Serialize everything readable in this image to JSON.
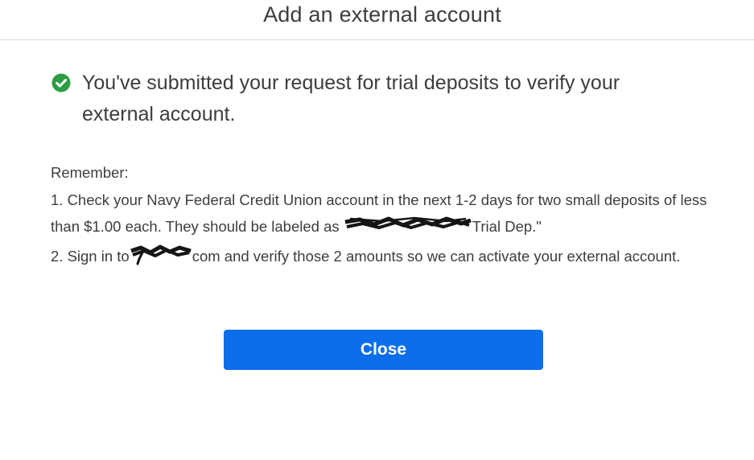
{
  "dialog": {
    "title": "Add an external account"
  },
  "success": {
    "icon": "check-circle-icon",
    "icon_color": "#2e9e44",
    "message": "You've submitted your request for trial deposits to verify your external account."
  },
  "reminder": {
    "heading": "Remember:",
    "step1_text_a": "1. Check your Navy Federal Credit Union account in the next 1-2 days for two small deposits of less than $1.00 each. They should be labeled as ",
    "step1_text_b": "Trial Dep.\"",
    "step2_text_a": "2. Sign in to",
    "step2_text_b": "com and verify those 2 amounts so we can activate your external account."
  },
  "actions": {
    "close_label": "Close",
    "close_color": "#0d6eeb"
  }
}
